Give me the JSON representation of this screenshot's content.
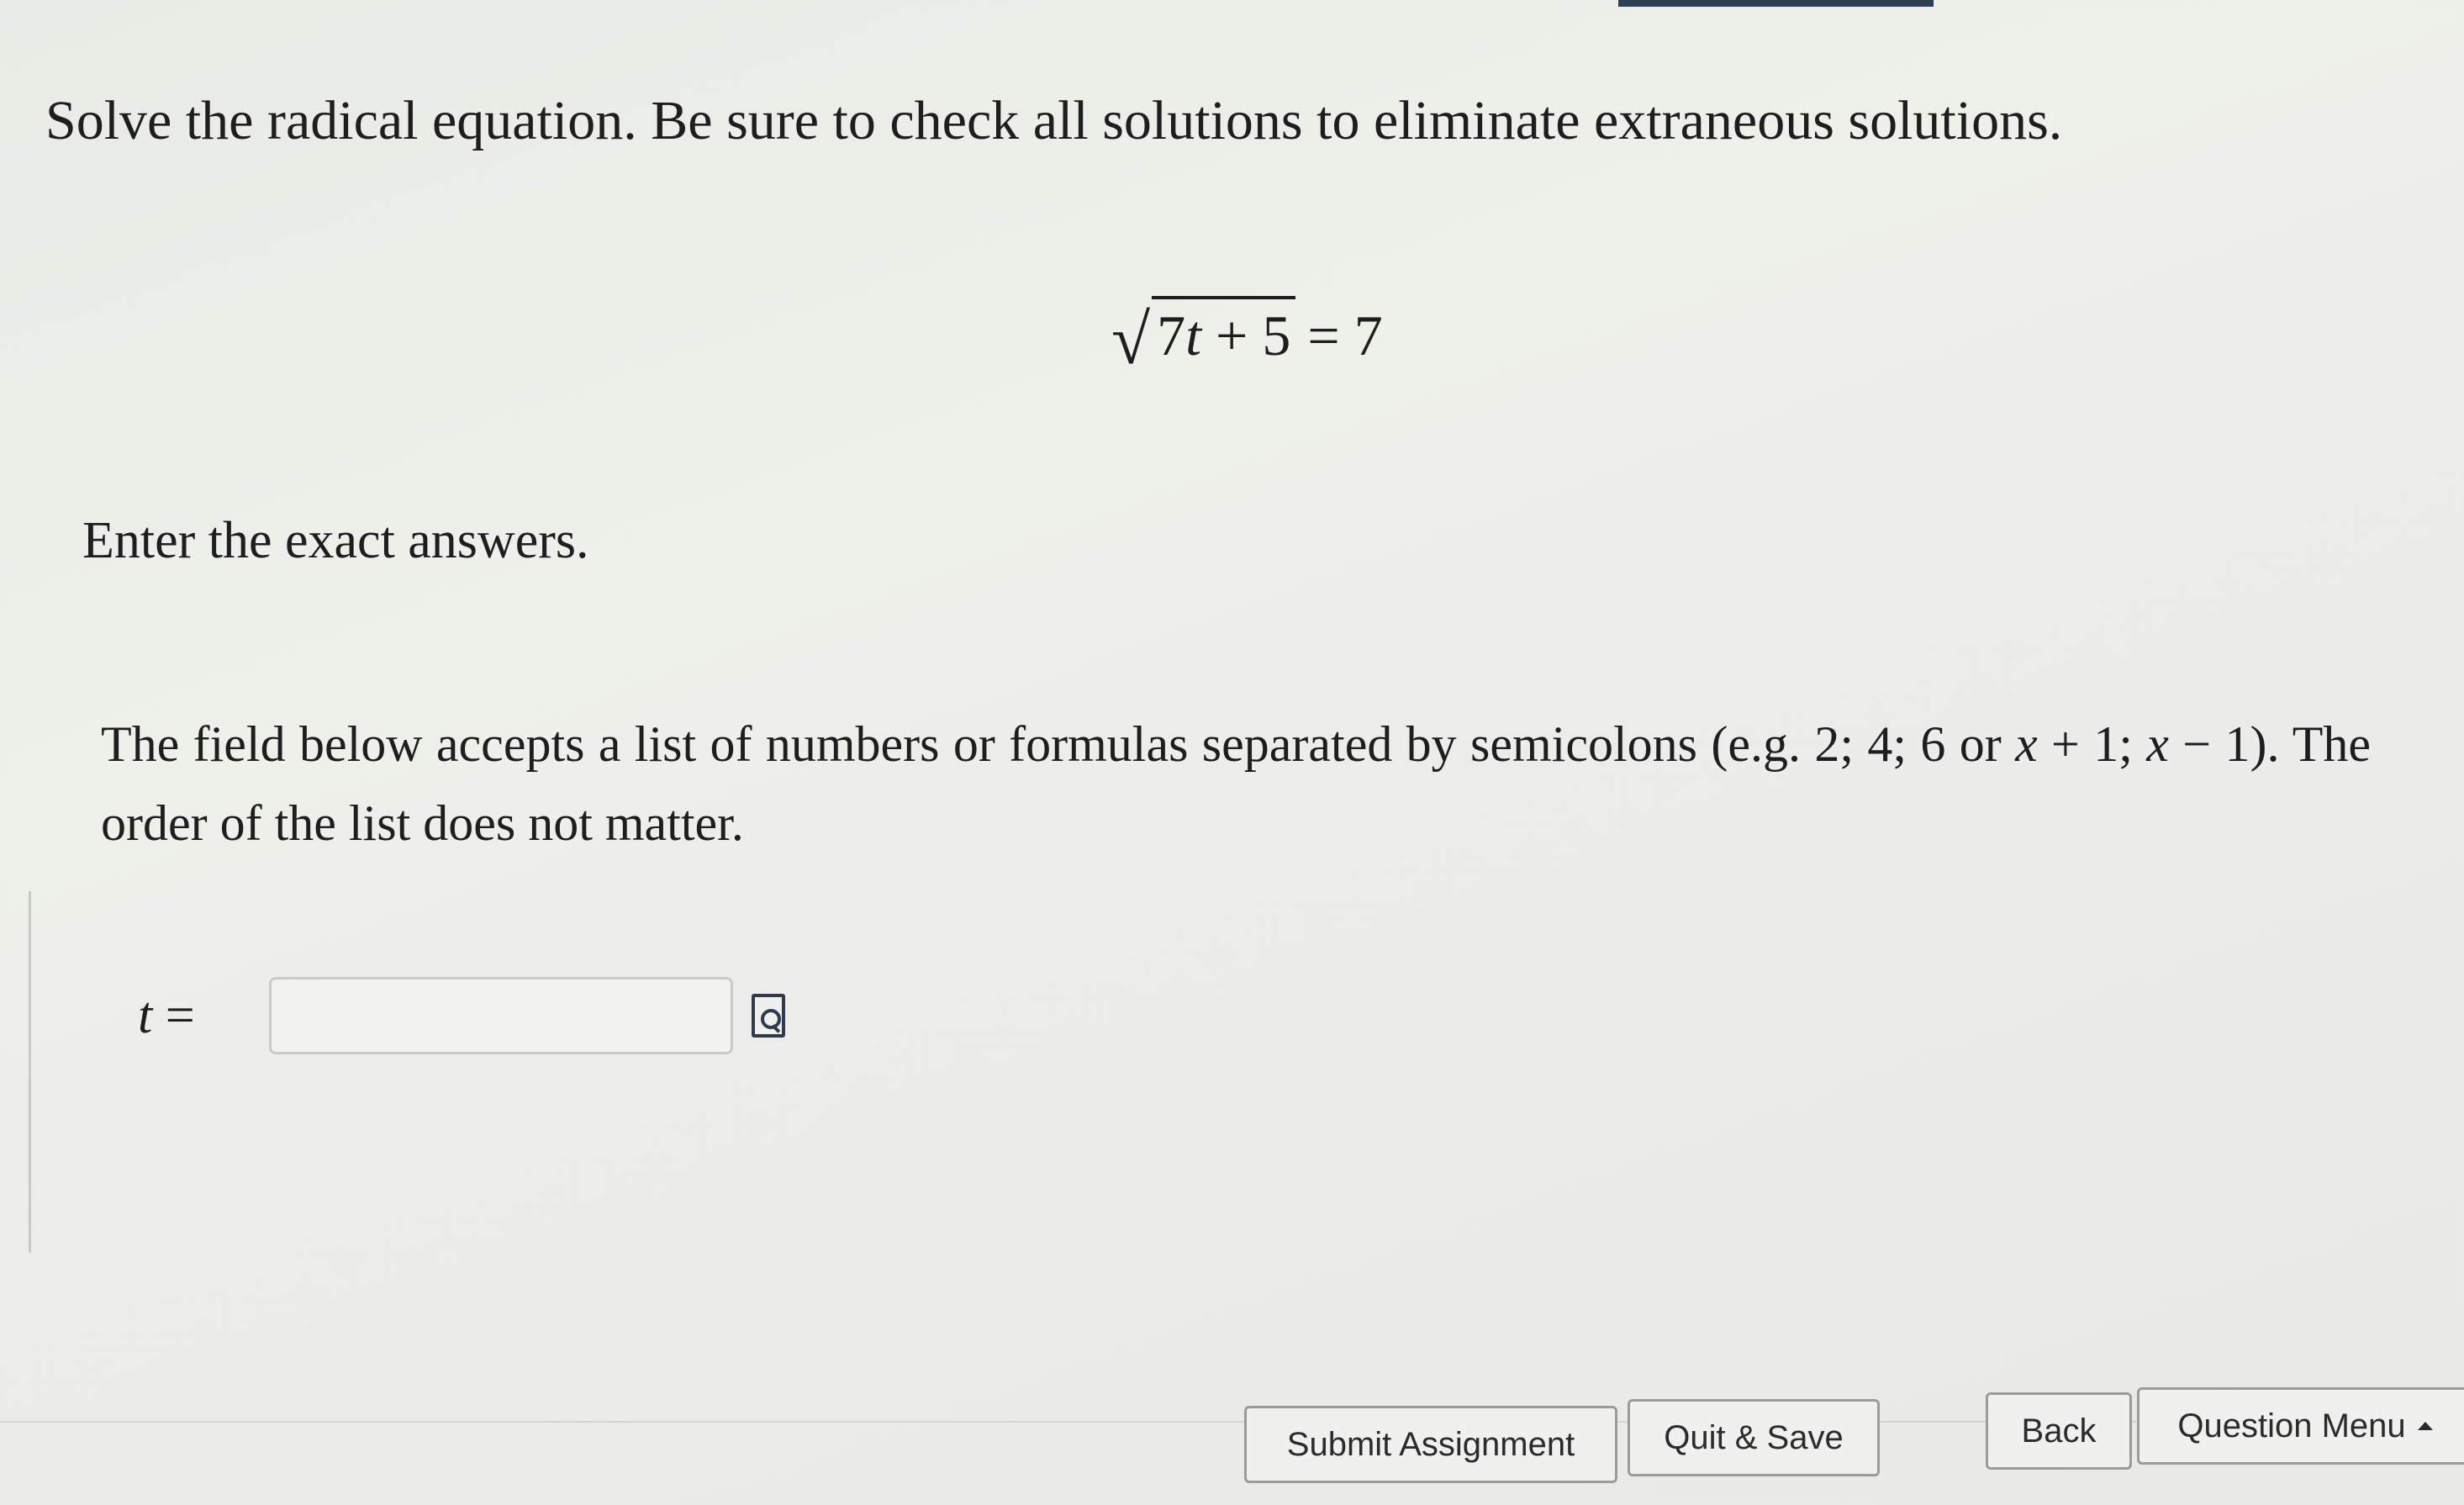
{
  "question": {
    "instruction": "Solve the radical equation. Be sure to check all solutions to eliminate extraneous solutions.",
    "equation": {
      "radicand_coef": "7",
      "radicand_var": "t",
      "radicand_rest": " + 5",
      "rhs": " = 7"
    },
    "prompt": "Enter the exact answers.",
    "hint": {
      "part1": "The field below accepts a list of numbers or formulas separated by semicolons (e.g. 2; 4; 6 or ",
      "x1": "x",
      "part2": " + 1; ",
      "x2": "x",
      "part3": " − 1). The order of the list does not matter."
    },
    "answer": {
      "variable": "t",
      "equals": " =",
      "value": "",
      "placeholder": ""
    }
  },
  "footer": {
    "submit_label": "Submit Assignment",
    "quit_label": "Quit & Save",
    "back_label": "Back",
    "menu_label": "Question Menu"
  },
  "icons": {
    "preview": "preview-icon",
    "menu_caret": "caret-up-icon"
  },
  "colors": {
    "top_bar": "#2d3f57",
    "text": "#1e1e1e"
  }
}
